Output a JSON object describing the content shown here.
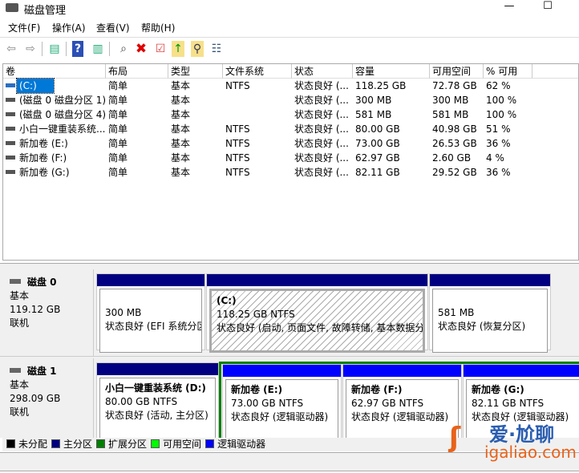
{
  "window": {
    "title": "磁盘管理",
    "minimize": "—",
    "maximize": "☐"
  },
  "menu": [
    "文件(F)",
    "操作(A)",
    "查看(V)",
    "帮助(H)"
  ],
  "toolbar": [
    "back",
    "forward",
    "console-tree",
    "help",
    "action-pane",
    "connect-disk",
    "delete",
    "properties",
    "upload-folder",
    "search-folder",
    "checklist"
  ],
  "columns": [
    "卷",
    "布局",
    "类型",
    "文件系统",
    "状态",
    "容量",
    "可用空间",
    "% 可用"
  ],
  "rows": [
    [
      "(C:)",
      "简单",
      "基本",
      "NTFS",
      "状态良好 (...",
      "118.25 GB",
      "72.78 GB",
      "62 %"
    ],
    [
      "(磁盘 0 磁盘分区 1)",
      "简单",
      "基本",
      "",
      "状态良好 (...",
      "300 MB",
      "300 MB",
      "100 %"
    ],
    [
      "(磁盘 0 磁盘分区 4)",
      "简单",
      "基本",
      "",
      "状态良好 (...",
      "581 MB",
      "581 MB",
      "100 %"
    ],
    [
      "小白一键重装系统...",
      "简单",
      "基本",
      "NTFS",
      "状态良好 (...",
      "80.00 GB",
      "40.98 GB",
      "51 %"
    ],
    [
      "新加卷 (E:)",
      "简单",
      "基本",
      "NTFS",
      "状态良好 (...",
      "73.00 GB",
      "26.53 GB",
      "36 %"
    ],
    [
      "新加卷 (F:)",
      "简单",
      "基本",
      "NTFS",
      "状态良好 (...",
      "62.97 GB",
      "2.60 GB",
      "4 %"
    ],
    [
      "新加卷 (G:)",
      "简单",
      "基本",
      "NTFS",
      "状态良好 (...",
      "82.11 GB",
      "29.52 GB",
      "36 %"
    ]
  ],
  "disks": [
    {
      "name": "磁盘 0",
      "type": "基本",
      "size": "119.12 GB",
      "status": "联机",
      "partitions": [
        {
          "title": "",
          "size": "300 MB",
          "status": "状态良好 (EFI 系统分区)"
        },
        {
          "title": "(C:)",
          "size": "118.25 GB NTFS",
          "status": "状态良好 (启动, 页面文件, 故障转储, 基本数据分区)"
        },
        {
          "title": "",
          "size": "581 MB",
          "status": "状态良好 (恢复分区)"
        }
      ]
    },
    {
      "name": "磁盘 1",
      "type": "基本",
      "size": "298.09 GB",
      "status": "联机",
      "partitions": [
        {
          "title": "小白一键重装系统  (D:)",
          "size": "80.00 GB NTFS",
          "status": "状态良好 (活动, 主分区)"
        },
        {
          "title": "新加卷  (E:)",
          "size": "73.00 GB NTFS",
          "status": "状态良好 (逻辑驱动器)"
        },
        {
          "title": "新加卷  (F:)",
          "size": "62.97 GB NTFS",
          "status": "状态良好 (逻辑驱动器)"
        },
        {
          "title": "新加卷  (G:)",
          "size": "82.11 GB NTFS",
          "status": "状态良好 (逻辑驱动器)"
        }
      ]
    }
  ],
  "legend": [
    {
      "label": "未分配",
      "color": "#000000"
    },
    {
      "label": "主分区",
      "color": "#000080"
    },
    {
      "label": "扩展分区",
      "color": "#008000"
    },
    {
      "label": "可用空间",
      "color": "#00ff00"
    },
    {
      "label": "逻辑驱动器",
      "color": "#0000ff"
    }
  ],
  "colors": {
    "primary": "#000080",
    "logical": "#0000ff",
    "extended": "#008000",
    "selection": "#0078d7"
  },
  "watermark": {
    "text": "爱·尬聊",
    "url_text": "igaliao.com"
  }
}
